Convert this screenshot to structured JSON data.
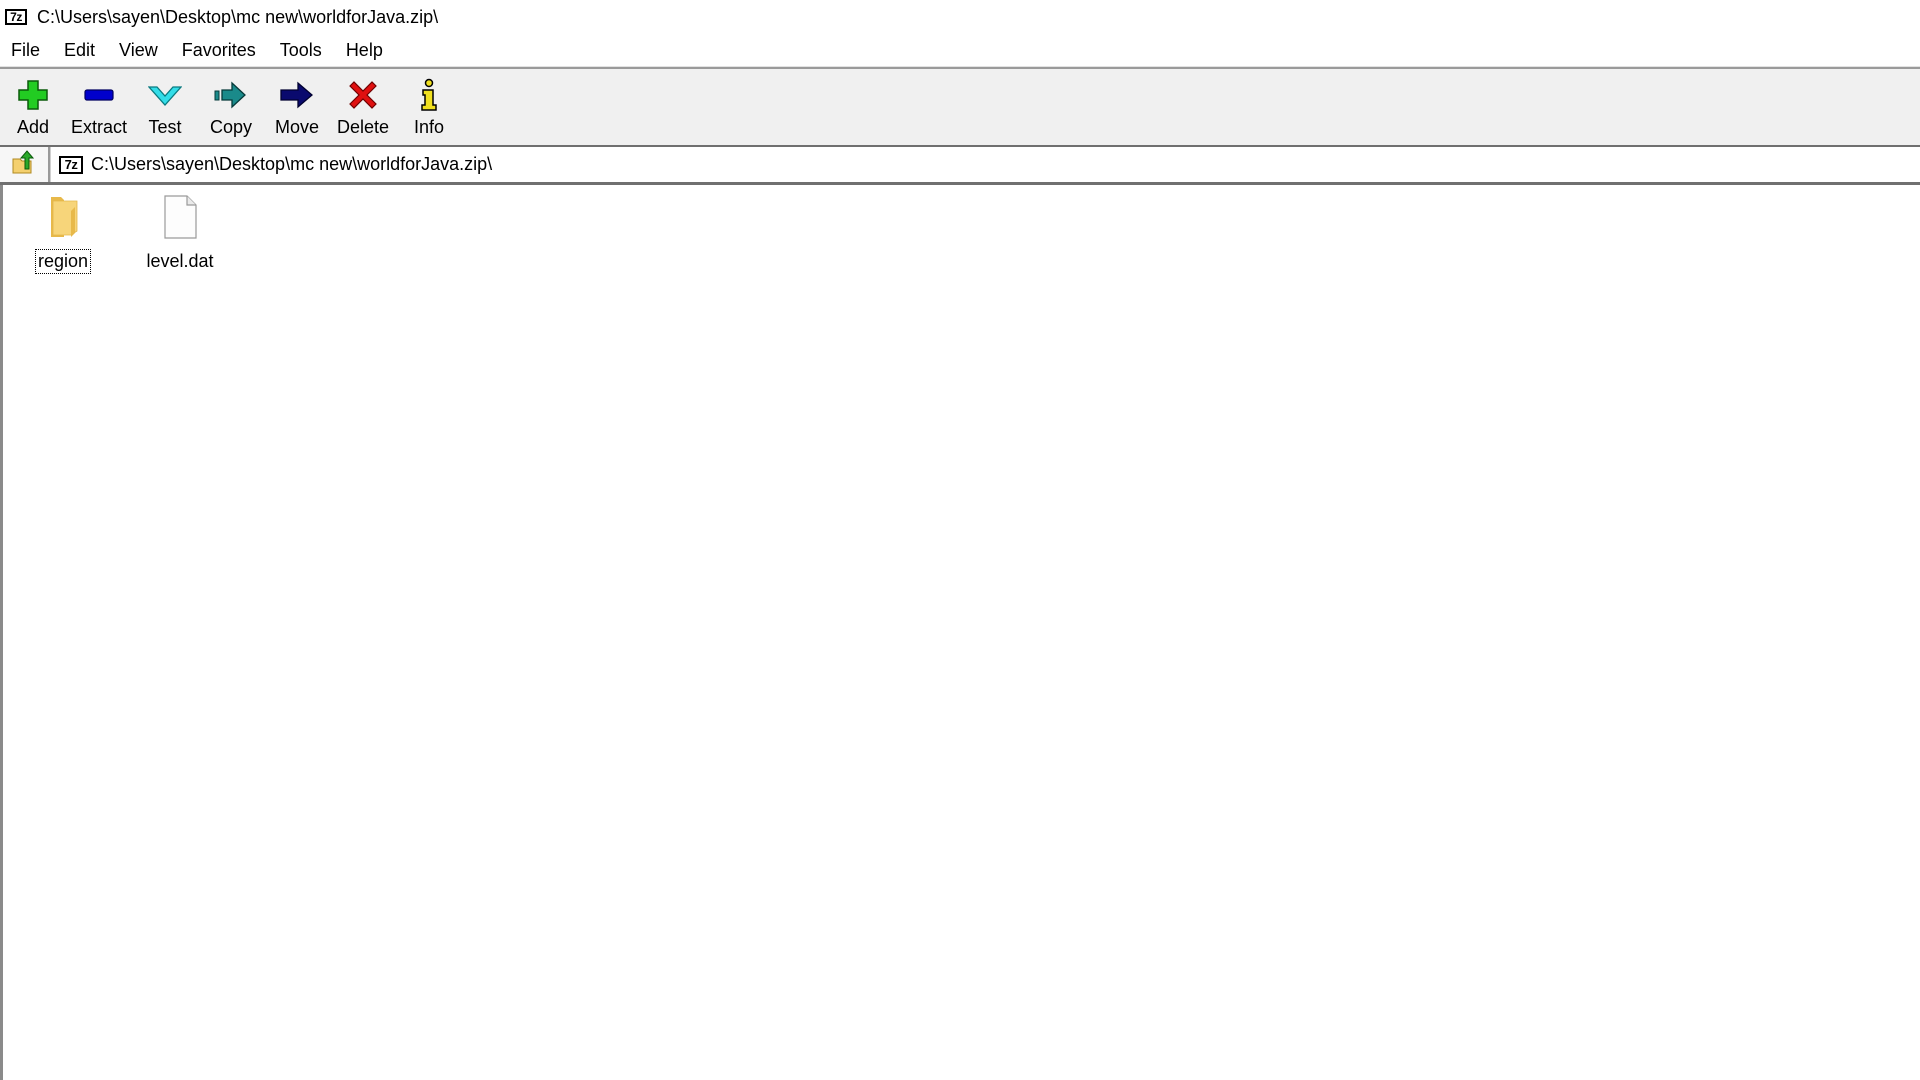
{
  "window": {
    "app_icon": "7z-app-icon",
    "app_icon_text": "7z",
    "title": "C:\\Users\\sayen\\Desktop\\mc new\\worldforJava.zip\\"
  },
  "menu": {
    "items": [
      {
        "label": "File"
      },
      {
        "label": "Edit"
      },
      {
        "label": "View"
      },
      {
        "label": "Favorites"
      },
      {
        "label": "Tools"
      },
      {
        "label": "Help"
      }
    ]
  },
  "toolbar": {
    "buttons": [
      {
        "label": "Add",
        "icon": "plus-icon",
        "color": "#22cc22"
      },
      {
        "label": "Extract",
        "icon": "minus-icon",
        "color": "#0000cc"
      },
      {
        "label": "Test",
        "icon": "checkmark-icon",
        "color": "#33dde8"
      },
      {
        "label": "Copy",
        "icon": "copy-arrow-icon",
        "color": "#1a8a8a"
      },
      {
        "label": "Move",
        "icon": "move-arrow-icon",
        "color": "#0a0a6e"
      },
      {
        "label": "Delete",
        "icon": "x-icon",
        "color": "#e01010"
      },
      {
        "label": "Info",
        "icon": "info-icon",
        "color": "#f0e020"
      }
    ]
  },
  "address_bar": {
    "up_icon": "folder-up-icon",
    "path": "C:\\Users\\sayen\\Desktop\\mc new\\worldforJava.zip\\"
  },
  "files": [
    {
      "name": "region",
      "type": "folder",
      "icon": "folder-icon",
      "focused": true
    },
    {
      "name": "level.dat",
      "type": "file",
      "icon": "file-icon",
      "focused": false
    }
  ]
}
